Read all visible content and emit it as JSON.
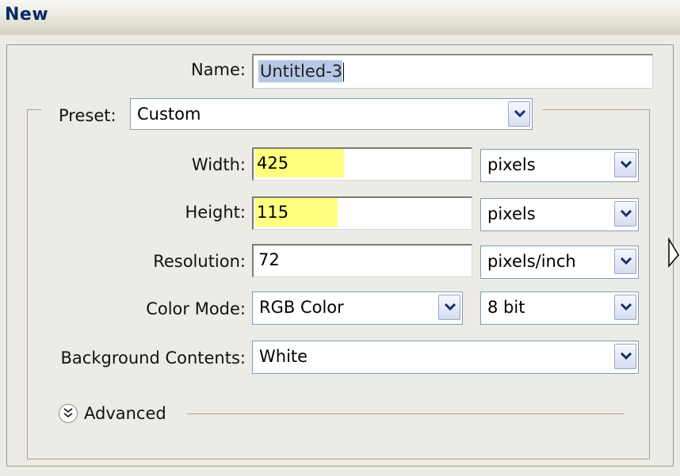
{
  "dialog": {
    "title": "New"
  },
  "name": {
    "label": "Name:",
    "value": "Untitled-3"
  },
  "preset": {
    "label": "Preset:",
    "value": "Custom"
  },
  "width": {
    "label": "Width:",
    "value": "425",
    "unit": "pixels"
  },
  "height": {
    "label": "Height:",
    "value": "115",
    "unit": "pixels"
  },
  "resolution": {
    "label": "Resolution:",
    "value": "72",
    "unit": "pixels/inch"
  },
  "color_mode": {
    "label": "Color Mode:",
    "value": "RGB Color",
    "bit_depth": "8 bit"
  },
  "background": {
    "label": "Background Contents:",
    "value": "White"
  },
  "advanced": {
    "label": "Advanced",
    "icon": "chevron-double-down-icon"
  },
  "colors": {
    "highlight": "#ffff80",
    "selection": "#b7c8e6",
    "title_text": "#0b2a66"
  }
}
